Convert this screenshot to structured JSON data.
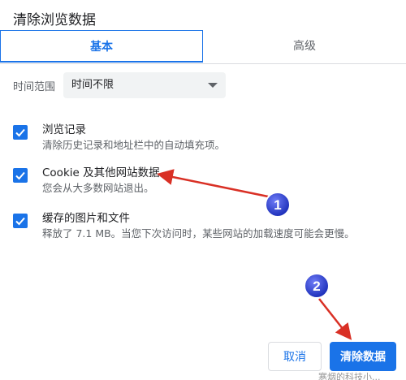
{
  "dialog": {
    "title": "清除浏览数据"
  },
  "tabs": [
    {
      "label": "基本",
      "active": true
    },
    {
      "label": "高级",
      "active": false
    }
  ],
  "time_range": {
    "label": "时间范围",
    "value": "时间不限"
  },
  "options": [
    {
      "title": "浏览记录",
      "desc": "清除历史记录和地址栏中的自动填充项。",
      "checked": true
    },
    {
      "title": "Cookie 及其他网站数据",
      "desc": "您会从大多数网站退出。",
      "checked": true
    },
    {
      "title": "缓存的图片和文件",
      "desc": "释放了 7.1 MB。当您下次访问时，某些网站的加载速度可能会更慢。",
      "checked": true
    }
  ],
  "buttons": {
    "cancel": "取消",
    "clear": "清除数据"
  },
  "annotations": {
    "marker1": "1",
    "marker2": "2"
  },
  "watermark": "寒烟的科技小..."
}
